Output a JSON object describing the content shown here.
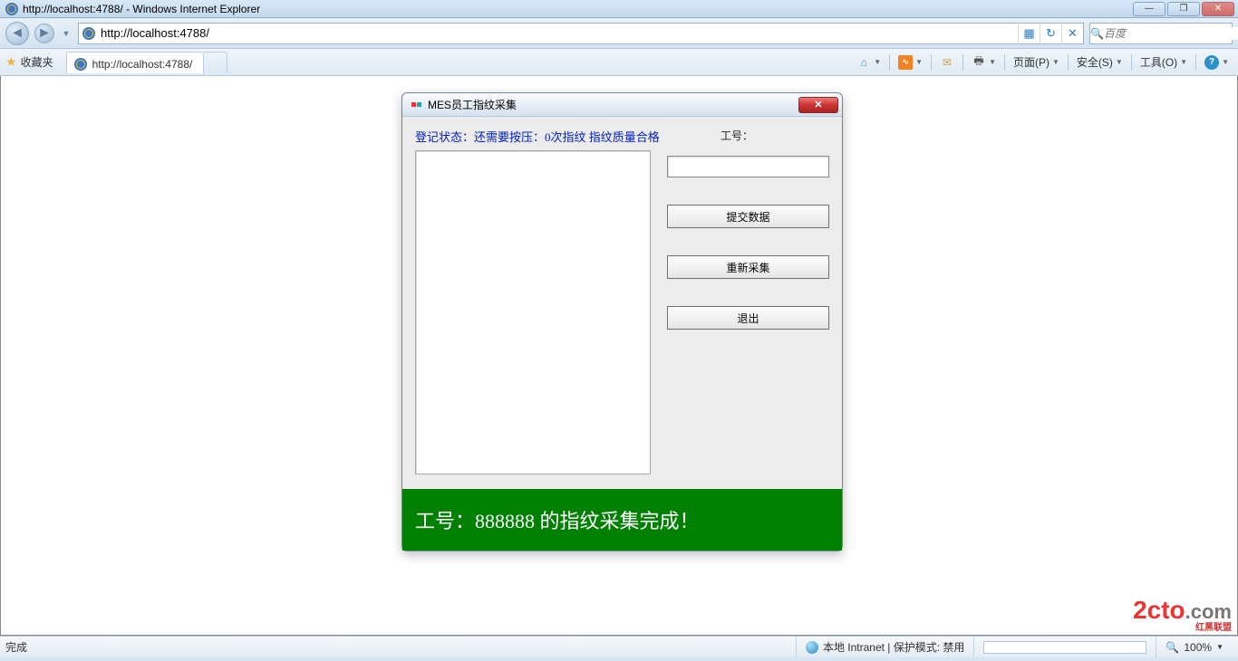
{
  "window": {
    "title": "http://localhost:4788/ - Windows Internet Explorer",
    "min": "—",
    "max": "❐",
    "close": "✕"
  },
  "nav": {
    "back": "◄",
    "forward": "►",
    "address": "http://localhost:4788/",
    "refresh": "↻",
    "stop": "✕",
    "search_placeholder": "百度",
    "search_icon": "🔍"
  },
  "cmdbar": {
    "favorites": "收藏夹",
    "tab_title": "http://localhost:4788/",
    "menu": {
      "page": "页面(P)",
      "safety": "安全(S)",
      "tools": "工具(O)"
    }
  },
  "dialog": {
    "title": "MES员工指纹采集",
    "status": "登记状态：还需要按压：0次指纹 指纹质量合格",
    "label_id": "工号：",
    "id_value": "",
    "btn_submit": "提交数据",
    "btn_retry": "重新采集",
    "btn_exit": "退出",
    "banner": "工号：888888  的指纹采集完成！"
  },
  "statusbar": {
    "done": "完成",
    "zone": "本地 Intranet | 保护模式: 禁用",
    "zoom": "100%"
  },
  "watermark": {
    "text": "2cto",
    "suffix": ".com",
    "cn": "红黑联盟"
  }
}
